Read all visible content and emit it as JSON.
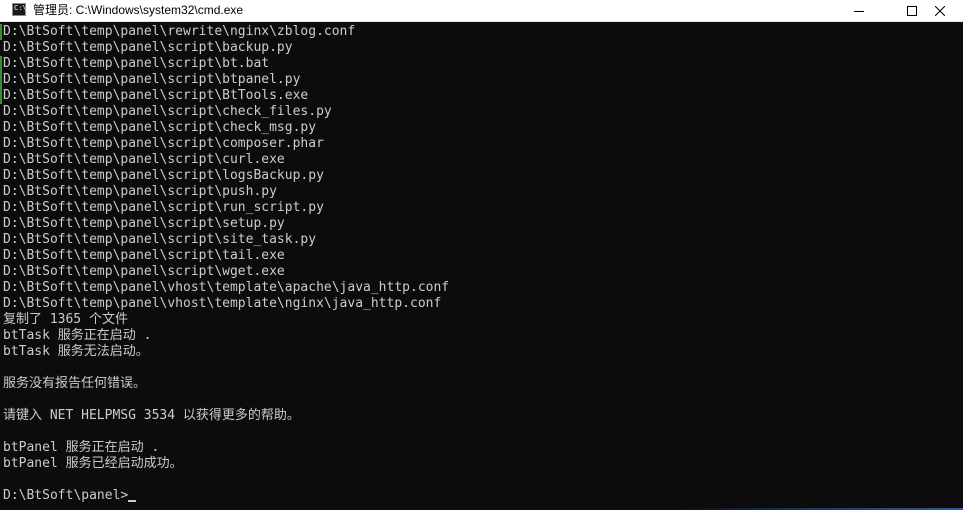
{
  "window": {
    "title": "管理员: C:\\Windows\\system32\\cmd.exe",
    "icon": "cmd-icon",
    "icon_glyph": "C:\\"
  },
  "console": {
    "lines": [
      "D:\\BtSoft\\temp\\panel\\rewrite\\nginx\\zblog.conf",
      "D:\\BtSoft\\temp\\panel\\script\\backup.py",
      "D:\\BtSoft\\temp\\panel\\script\\bt.bat",
      "D:\\BtSoft\\temp\\panel\\script\\btpanel.py",
      "D:\\BtSoft\\temp\\panel\\script\\BtTools.exe",
      "D:\\BtSoft\\temp\\panel\\script\\check_files.py",
      "D:\\BtSoft\\temp\\panel\\script\\check_msg.py",
      "D:\\BtSoft\\temp\\panel\\script\\composer.phar",
      "D:\\BtSoft\\temp\\panel\\script\\curl.exe",
      "D:\\BtSoft\\temp\\panel\\script\\logsBackup.py",
      "D:\\BtSoft\\temp\\panel\\script\\push.py",
      "D:\\BtSoft\\temp\\panel\\script\\run_script.py",
      "D:\\BtSoft\\temp\\panel\\script\\setup.py",
      "D:\\BtSoft\\temp\\panel\\script\\site_task.py",
      "D:\\BtSoft\\temp\\panel\\script\\tail.exe",
      "D:\\BtSoft\\temp\\panel\\script\\wget.exe",
      "D:\\BtSoft\\temp\\panel\\vhost\\template\\apache\\java_http.conf",
      "D:\\BtSoft\\temp\\panel\\vhost\\template\\nginx\\java_http.conf",
      "复制了 1365 个文件",
      "btTask 服务正在启动 .",
      "btTask 服务无法启动。",
      "",
      "服务没有报告任何错误。",
      "",
      "请键入 NET HELPMSG 3534 以获得更多的帮助。",
      "",
      "btPanel 服务正在启动 .",
      "btPanel 服务已经启动成功。",
      ""
    ],
    "prompt": "D:\\BtSoft\\panel>"
  },
  "colors": {
    "background": "#0c0c0c",
    "foreground": "#cccccc",
    "titlebar": "#ffffff"
  }
}
